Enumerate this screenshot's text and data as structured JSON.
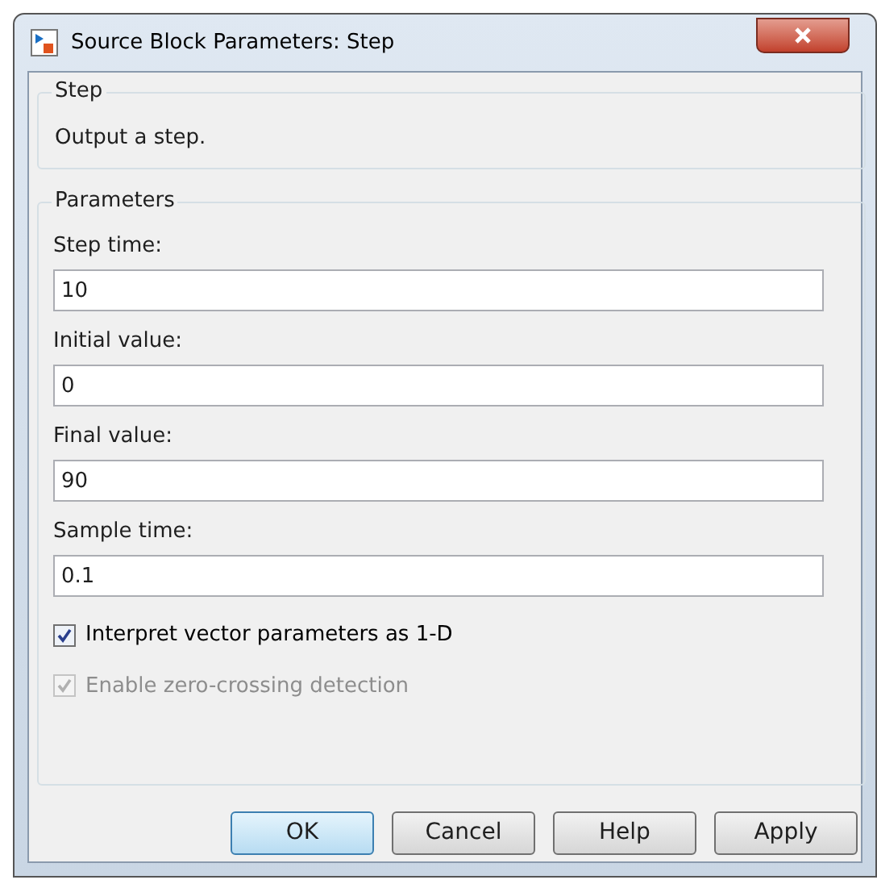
{
  "window": {
    "title": "Source Block Parameters: Step"
  },
  "description_group": {
    "title": "Step",
    "text": "Output a step."
  },
  "parameters_group": {
    "title": "Parameters",
    "fields": [
      {
        "label": "Step time:",
        "value": "10"
      },
      {
        "label": "Initial value:",
        "value": "0"
      },
      {
        "label": "Final value:",
        "value": "90"
      },
      {
        "label": "Sample time:",
        "value": "0.1"
      }
    ],
    "checkboxes": [
      {
        "label": "Interpret vector parameters as 1-D",
        "checked": true,
        "disabled": false
      },
      {
        "label": "Enable zero-crossing detection",
        "checked": true,
        "disabled": true
      }
    ]
  },
  "buttons": [
    {
      "label": "OK",
      "default": true
    },
    {
      "label": "Cancel",
      "default": false
    },
    {
      "label": "Help",
      "default": false
    },
    {
      "label": "Apply",
      "default": false
    }
  ]
}
